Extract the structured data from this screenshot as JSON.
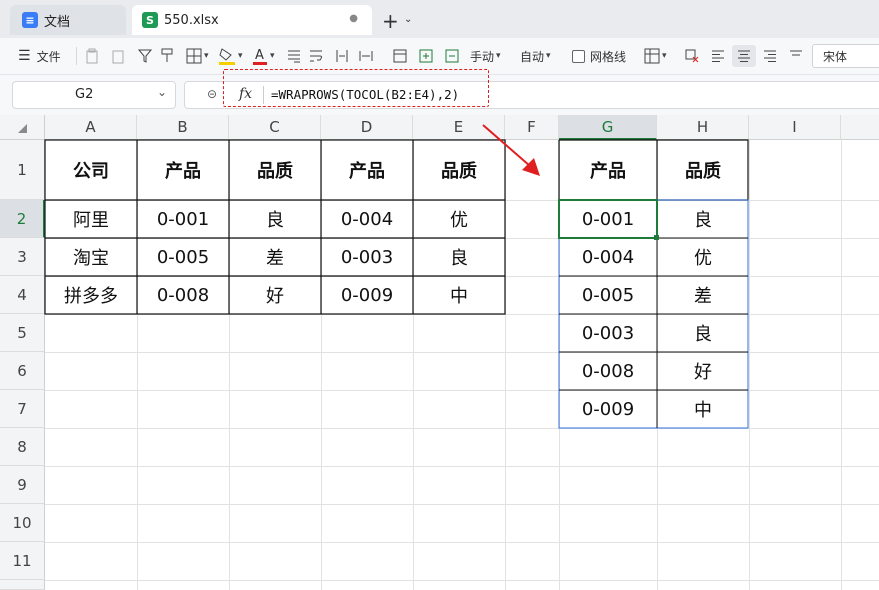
{
  "tabs": [
    {
      "label": "文档",
      "icon": "document-icon"
    },
    {
      "label": "550.xlsx",
      "icon": "sheet-s-icon",
      "badge": "S"
    }
  ],
  "toolbar": {
    "file_label": "文件",
    "manual_label": "手动",
    "auto_label": "自动",
    "gridlines_label": "网格线",
    "font_name": "宋体",
    "font_color": "#e02020",
    "fill_color": "#f5d000"
  },
  "formula_bar": {
    "cell_ref": "G2",
    "fx_label": "fx",
    "formula": "=WRAPROWS(TOCOL(B2:E4),2)"
  },
  "columns": [
    "A",
    "B",
    "C",
    "D",
    "E",
    "F",
    "G",
    "H",
    "I"
  ],
  "rows": [
    "1",
    "2",
    "3",
    "4",
    "5",
    "6",
    "7",
    "8",
    "9",
    "10",
    "11"
  ],
  "source_table": {
    "headers": [
      "公司",
      "产品",
      "品质",
      "产品",
      "品质"
    ],
    "rows": [
      [
        "阿里",
        "0-001",
        "良",
        "0-004",
        "优"
      ],
      [
        "淘宝",
        "0-005",
        "差",
        "0-003",
        "良"
      ],
      [
        "拼多多",
        "0-008",
        "好",
        "0-009",
        "中"
      ]
    ]
  },
  "result_table": {
    "headers": [
      "产品",
      "品质"
    ],
    "rows": [
      [
        "0-001",
        "良"
      ],
      [
        "0-004",
        "优"
      ],
      [
        "0-005",
        "差"
      ],
      [
        "0-003",
        "良"
      ],
      [
        "0-008",
        "好"
      ],
      [
        "0-009",
        "中"
      ]
    ]
  },
  "colors": {
    "accent_green": "#1e7b3a",
    "annotation_red": "#e02020",
    "selection_blue": "#2f6fdc"
  }
}
